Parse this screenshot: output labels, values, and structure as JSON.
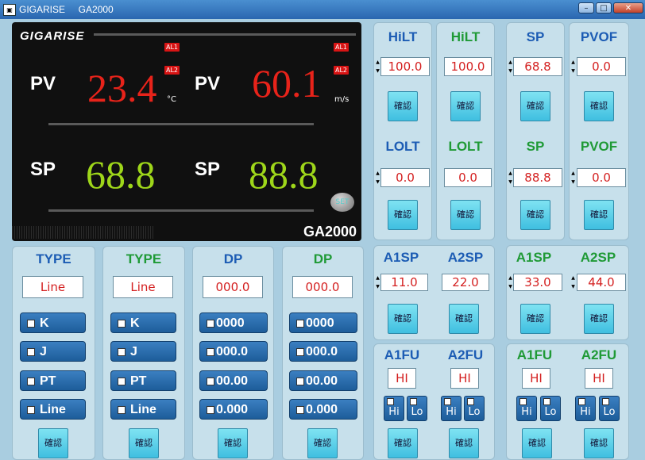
{
  "window": {
    "title": "GIGARISE     GA2000",
    "icon_text": "▣",
    "min_label": "–",
    "max_label": "□",
    "close_label": "✕"
  },
  "display": {
    "logo": "GIGARISE",
    "pv_label": "PV",
    "sp_label": "SP",
    "pv1": "23.4",
    "pv1_unit": "°C",
    "pv2": "60.1",
    "pv2_unit": "m/s",
    "sp1": "68.8",
    "sp2": "88.8",
    "al1": "AL1",
    "al2": "AL2",
    "set_button": "SET",
    "model": "GA2000"
  },
  "confirm_label": "確認",
  "top": {
    "hilt1": {
      "title": "HiLT",
      "value": "100.0"
    },
    "hilt2": {
      "title": "HiLT",
      "value": "100.0"
    },
    "sp1": {
      "title": "SP",
      "value": "68.8"
    },
    "pvof1": {
      "title": "PVOF",
      "value": "0.0"
    },
    "lolt1": {
      "title": "LOLT",
      "value": "0.0"
    },
    "lolt2": {
      "title": "LOLT",
      "value": "0.0"
    },
    "sp2": {
      "title": "SP",
      "value": "88.8"
    },
    "pvof2": {
      "title": "PVOF",
      "value": "0.0"
    }
  },
  "alarm": {
    "a1sp_l": {
      "title": "A1SP",
      "value": "11.0"
    },
    "a2sp_l": {
      "title": "A2SP",
      "value": "22.0"
    },
    "a1sp_r": {
      "title": "A1SP",
      "value": "33.0"
    },
    "a2sp_r": {
      "title": "A2SP",
      "value": "44.0"
    },
    "a1fu_l": {
      "title": "A1FU",
      "value": "HI"
    },
    "a2fu_l": {
      "title": "A2FU",
      "value": "HI"
    },
    "a1fu_r": {
      "title": "A1FU",
      "value": "HI"
    },
    "a2fu_r": {
      "title": "A2FU",
      "value": "HI"
    },
    "hi": "Hi",
    "lo": "Lo"
  },
  "type1": {
    "title": "TYPE",
    "value": "Line",
    "options": [
      "K",
      "J",
      "PT",
      "Line"
    ]
  },
  "type2": {
    "title": "TYPE",
    "value": "Line",
    "options": [
      "K",
      "J",
      "PT",
      "Line"
    ]
  },
  "dp1": {
    "title": "DP",
    "value": "000.0",
    "options": [
      "0000",
      "000.0",
      "00.00",
      "0.000"
    ]
  },
  "dp2": {
    "title": "DP",
    "value": "000.0",
    "options": [
      "0000",
      "000.0",
      "00.00",
      "0.000"
    ]
  }
}
